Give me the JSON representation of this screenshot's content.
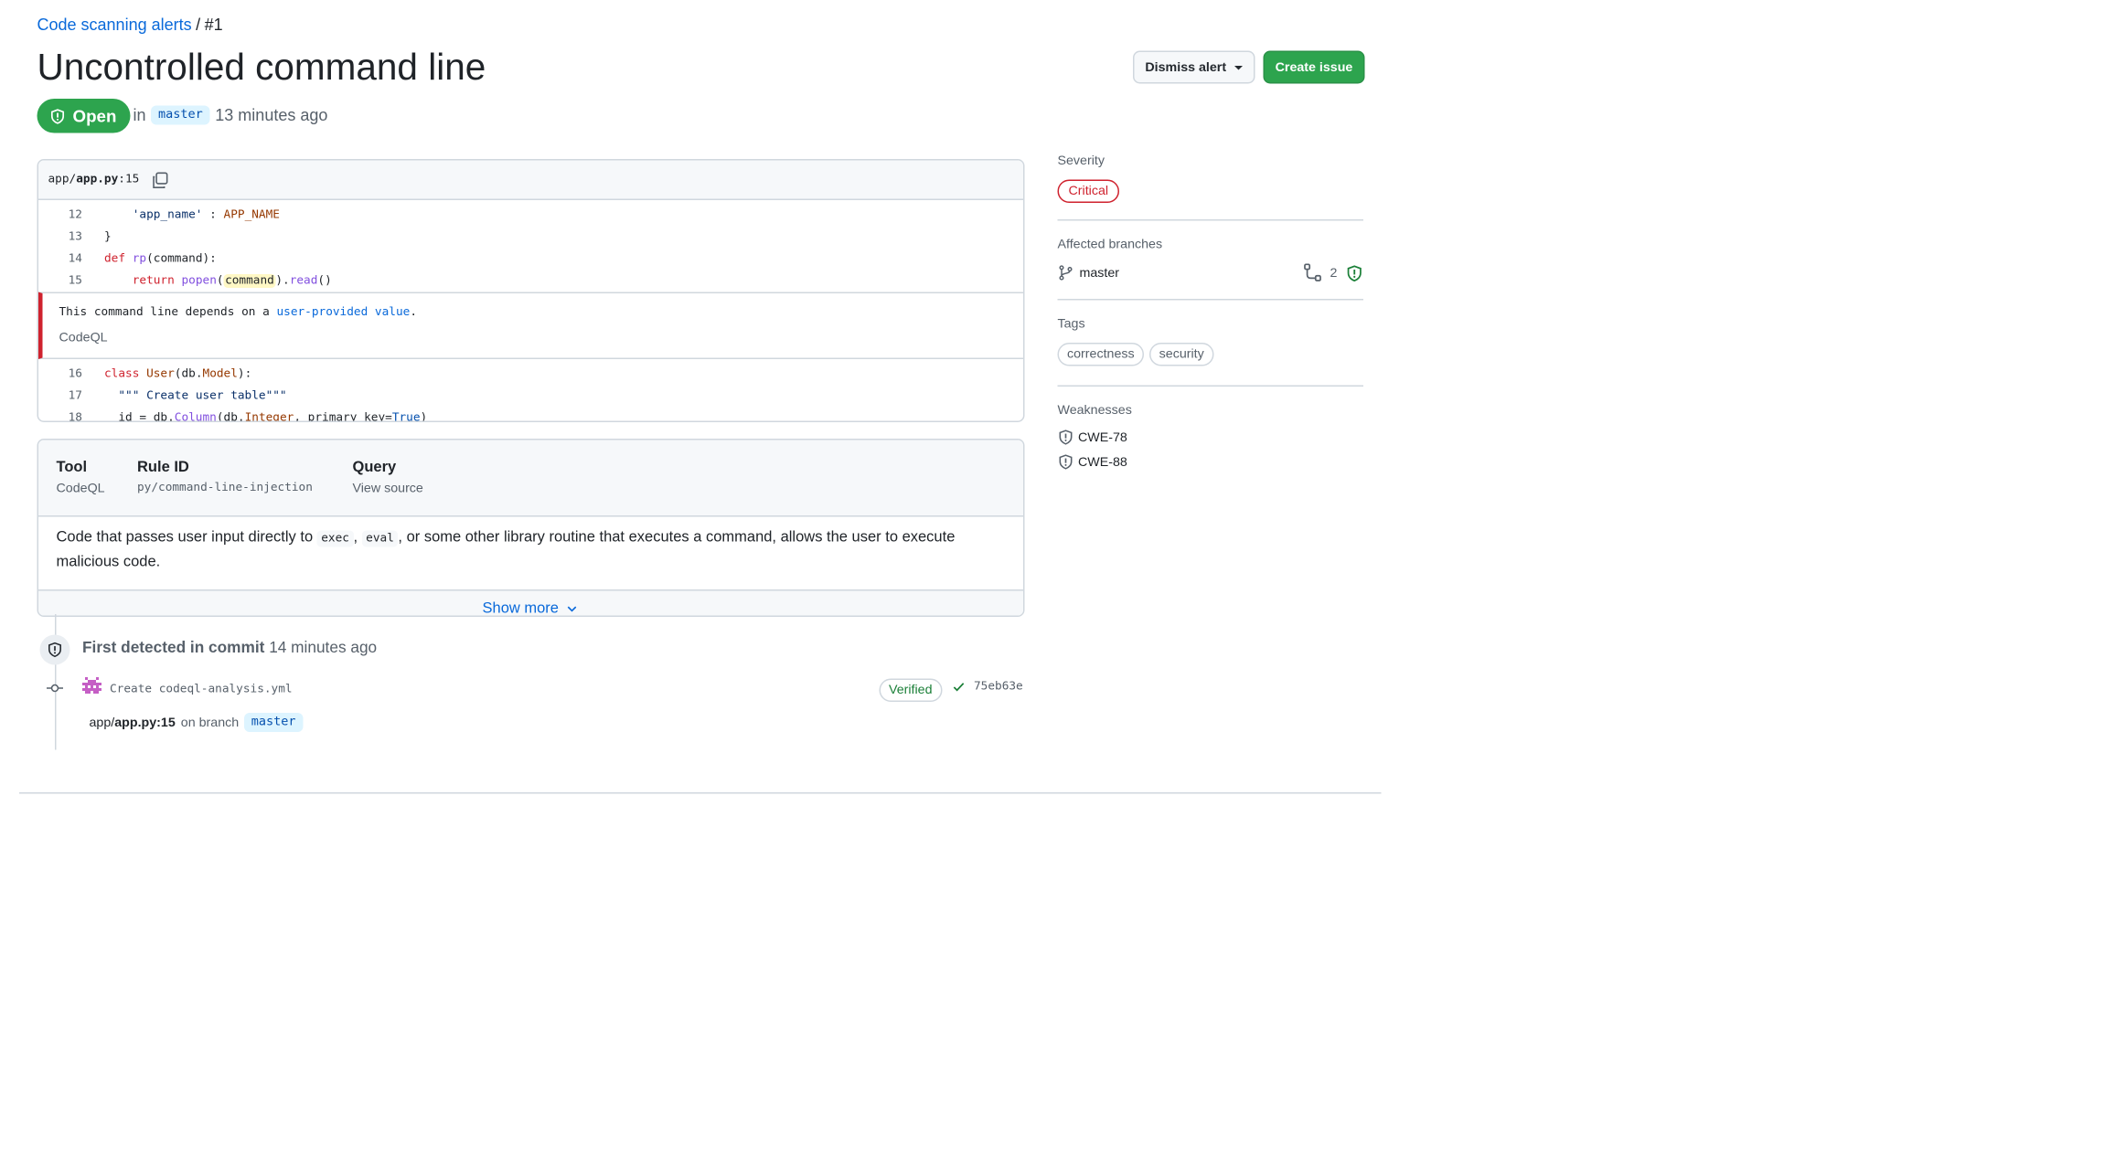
{
  "breadcrumb": {
    "link": "Code scanning alerts",
    "separator": "/",
    "current": "#1"
  },
  "title": "Uncontrolled command line",
  "status": {
    "label": "Open",
    "in": "in",
    "branch": "master",
    "time": "13 minutes ago"
  },
  "actions": {
    "dismiss": "Dismiss alert",
    "create": "Create issue"
  },
  "code": {
    "file_dir": "app/",
    "file_name": "app.py",
    "file_line": ":15",
    "lines": [
      {
        "n": "12"
      },
      {
        "n": "13"
      },
      {
        "n": "14"
      },
      {
        "n": "15"
      },
      {
        "n": "16"
      },
      {
        "n": "17"
      },
      {
        "n": "18"
      }
    ],
    "alert_message_pre": "This command line depends on a ",
    "alert_message_link": "user-provided value",
    "alert_message_post": ".",
    "alert_source": "CodeQL"
  },
  "info": {
    "tool_h": "Tool",
    "tool_v": "CodeQL",
    "rule_h": "Rule ID",
    "rule_v": "py/command-line-injection",
    "query_h": "Query",
    "query_v": "View source",
    "desc_1": "Code that passes user input directly to ",
    "desc_exec": "exec",
    "desc_comma": ",",
    "desc_eval": "eval",
    "desc_2": ", or some other library routine that executes a command, allows the user to execute malicious code.",
    "show_more": "Show more"
  },
  "timeline": {
    "title_bold": "First detected in commit",
    "title_time": "14 minutes ago",
    "commit_msg": "Create codeql-analysis.yml",
    "verified": "Verified",
    "sha": "75eb63e",
    "loc_dir": "app/",
    "loc_file": "app.py:15",
    "loc_on": "on branch",
    "loc_branch": "master"
  },
  "sidebar": {
    "severity_label": "Severity",
    "severity": "Critical",
    "branches_label": "Affected branches",
    "branch": "master",
    "branch_count": "2",
    "tags_label": "Tags",
    "tags": [
      "correctness",
      "security"
    ],
    "weak_label": "Weaknesses",
    "weaknesses": [
      "CWE-78",
      "CWE-88"
    ]
  },
  "colors": {
    "green": "#2da44e",
    "red": "#cf222e",
    "link": "#0969da"
  }
}
